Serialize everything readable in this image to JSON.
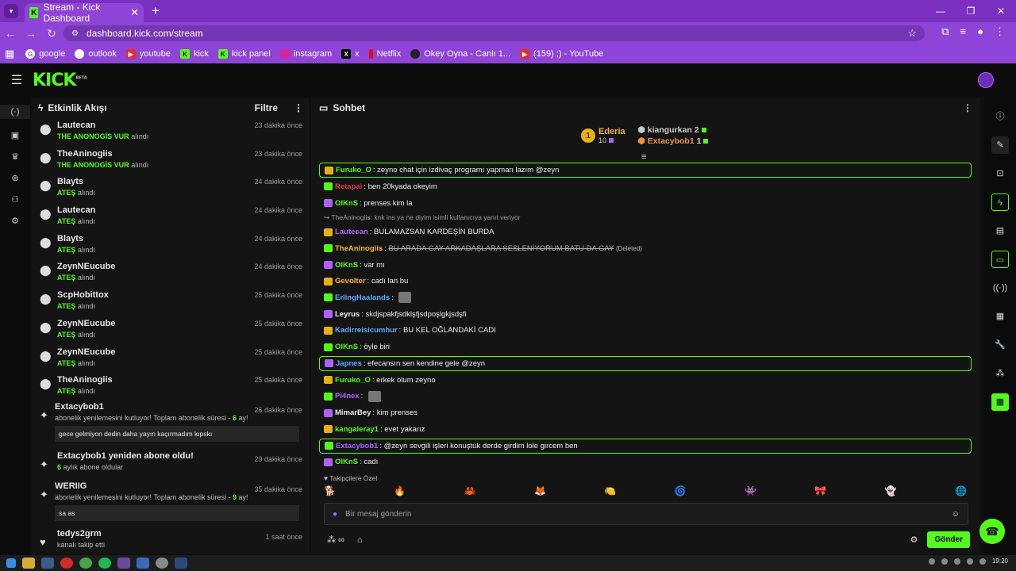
{
  "browser": {
    "tab_title": "Stream - Kick Dashboard",
    "url": "dashboard.kick.com/stream",
    "bookmarks": [
      "google",
      "outlook",
      "youtube",
      "kick",
      "kick panel",
      "instagram",
      "x",
      "Netflix",
      "Okey Oyna - Canlı 1...",
      "(159) ;) - YouTube"
    ]
  },
  "header": {
    "logo": "KICK",
    "beta": "BETA"
  },
  "activity": {
    "title": "Etkinlik Akışı",
    "filter": "Filtre",
    "items": [
      {
        "name": "Lautecan",
        "reward": "THE ANONOGİS VUR",
        "suffix": "alındı",
        "time": "23 dakika önce"
      },
      {
        "name": "TheAninogiis",
        "reward": "THE ANONOGİS VUR",
        "suffix": "alındı",
        "time": "23 dakika önce"
      },
      {
        "name": "Blayts",
        "reward": "ATEŞ",
        "suffix": "alındı",
        "time": "24 dakika önce"
      },
      {
        "name": "Lautecan",
        "reward": "ATEŞ",
        "suffix": "alındı",
        "time": "24 dakika önce"
      },
      {
        "name": "Blayts",
        "reward": "ATEŞ",
        "suffix": "alındı",
        "time": "24 dakika önce"
      },
      {
        "name": "ZeynNEucube",
        "reward": "ATEŞ",
        "suffix": "alındı",
        "time": "24 dakika önce"
      },
      {
        "name": "ScpHobittox",
        "reward": "ATEŞ",
        "suffix": "alındı",
        "time": "25 dakika önce"
      },
      {
        "name": "ZeynNEucube",
        "reward": "ATEŞ",
        "suffix": "alındı",
        "time": "25 dakika önce"
      },
      {
        "name": "ZeynNEucube",
        "reward": "ATEŞ",
        "suffix": "alındı",
        "time": "25 dakika önce"
      },
      {
        "name": "TheAninogiis",
        "reward": "ATEŞ",
        "suffix": "alındı",
        "time": "25 dakika önce"
      }
    ],
    "subs": [
      {
        "name": "Extacybob1",
        "text": "abonelik yenilemesini kutluyor! Toplam abonelik süresi - ",
        "months": "6",
        "unit": " ay!",
        "message": "gece gelmiyon dedin daha yayın kaçırmadım kıpskı",
        "time": "26 dakika önce"
      },
      {
        "name": "Extacybob1 yeniden abone oldu!",
        "months": "6",
        "unit": " aylık abone oldular",
        "time": "29 dakika önce"
      },
      {
        "name": "WERIIG",
        "text": "abonelik yenilemesini kutluyor! Toplam abonelik süresi - ",
        "months": "9",
        "unit": " ay!",
        "message": "sa as",
        "time": "35 dakika önce"
      },
      {
        "name": "tedys2grm",
        "text": "kanalı takip etti",
        "time": "1 saat önce"
      }
    ]
  },
  "chat": {
    "title": "Sohbet",
    "pinned": {
      "top_rank": "1",
      "top_name": "Ederia",
      "top_count": "10",
      "second_name": "kiangurkan",
      "second_count": "2",
      "third_name": "Extacybob1",
      "third_count": "1"
    },
    "messages": [
      {
        "user": "Furuko_O",
        "color": "#53fc18",
        "text": "zeyno chat için izdivaç programı yapman lazım @zeyn",
        "hl": true
      },
      {
        "user": "Retapai",
        "color": "#e0364c",
        "text": "ben 20kyada okeyim"
      },
      {
        "user": "OlKnS",
        "color": "#53fc18",
        "text": "prenses kim la"
      },
      {
        "user": "Lautecan",
        "color": "#b060ff",
        "text": "BULAMAZSAN KARDEŞİN BURDA",
        "reply": "TheAninogiis: knk ins ya ne diyim isimli kullanıcıya yanıt veriyor"
      },
      {
        "user": "TheAninogiis",
        "color": "#f2b53b",
        "text": "BU ARADA GAY ARKADAŞLARA SESLENİYORUM BATU DA GAY",
        "deleted": "(Deleted)"
      },
      {
        "user": "OlKnS",
        "color": "#53fc18",
        "text": "var mı"
      },
      {
        "user": "Gevolter",
        "color": "#f2b53b",
        "text": "cadı lan bu"
      },
      {
        "user": "ErlingHaalands",
        "color": "#5aa9ff",
        "text": ""
      },
      {
        "user": "Leyrus",
        "color": "#eeeeee",
        "text": "skdjspakfjsdklşfjsdpoşlgkjsdşfi"
      },
      {
        "user": "Kadirreisicumhur",
        "color": "#5aa9ff",
        "text": "BU KEL OĞLANDAKİ CADI"
      },
      {
        "user": "OlKnS",
        "color": "#53fc18",
        "text": "öyle biri"
      },
      {
        "user": "Japnes",
        "color": "#5aa9ff",
        "text": "efecansın sen kendine gele @zeyn",
        "hl": true
      },
      {
        "user": "Furuko_O",
        "color": "#53fc18",
        "text": "erkek olum zeyno"
      },
      {
        "user": "Pi4nex",
        "color": "#b060ff",
        "text": ""
      },
      {
        "user": "MimarBey",
        "color": "#eeeeee",
        "text": "kim prenses"
      },
      {
        "user": "kangaleray1",
        "color": "#53fc18",
        "text": "evet yakarız"
      },
      {
        "user": "Extacybob1",
        "color": "#b060ff",
        "text": "@zeyn sevgili işleri konuştuk derde girdim lole gircem ben",
        "hl": true
      },
      {
        "user": "OlKnS",
        "color": "#53fc18",
        "text": "cadı"
      }
    ],
    "follower_label": "Takipçilere Özel",
    "placeholder": "Bir mesaj gönderin",
    "send": "Gönder"
  },
  "taskbar": {
    "clock": "19:20"
  }
}
